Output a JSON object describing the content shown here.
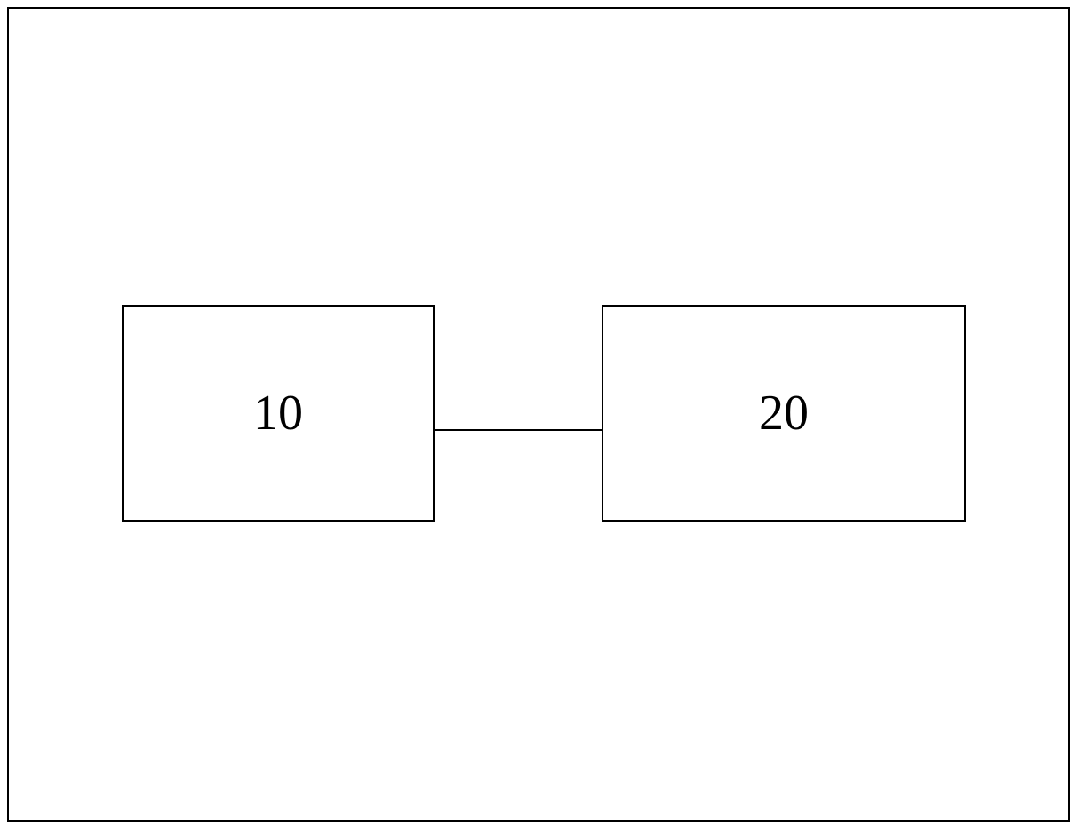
{
  "diagram": {
    "boxes": [
      {
        "id": "box-10",
        "label": "10"
      },
      {
        "id": "box-20",
        "label": "20"
      }
    ]
  }
}
